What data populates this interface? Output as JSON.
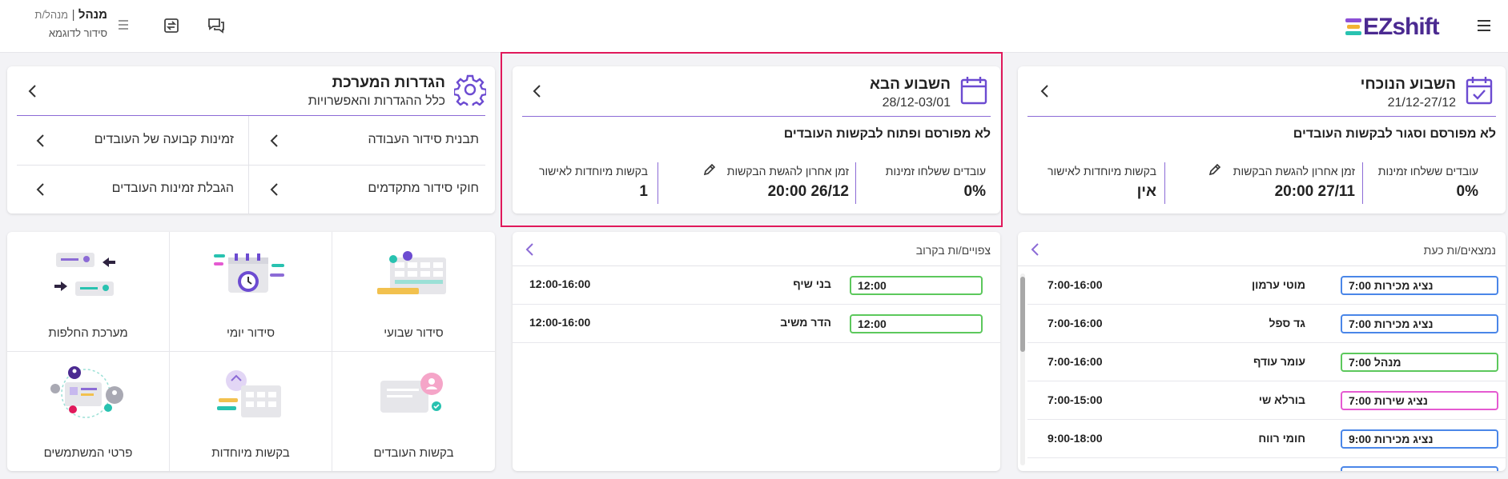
{
  "header": {
    "logo_text": "EZshift",
    "user_name": "מנהל",
    "user_role": "מנהל/ת",
    "separator": "|",
    "schedule_name": "סידור לדוגמא",
    "menu_icon": "hamburger-icon",
    "chat_icon": "chat-icon",
    "swap_icon": "swap-icon",
    "accent": "#6c4bd1"
  },
  "current_week": {
    "title": "השבוע הנוכחי",
    "dates": "21/12-27/12",
    "status": "לא מפורסם וסגור לבקשות העובדים",
    "stats": {
      "sent_label": "עובדים ששלחו זמינות",
      "sent_value": "0%",
      "deadline_label": "זמן אחרון להגשת הבקשות",
      "deadline_value": "27/11 20:00",
      "special_label": "בקשות מיוחדות לאישור",
      "special_value": "אין"
    }
  },
  "next_week": {
    "title": "השבוע הבא",
    "dates": "28/12-03/01",
    "status": "לא מפורסם ופתוח לבקשות העובדים",
    "stats": {
      "sent_label": "עובדים ששלחו זמינות",
      "sent_value": "0%",
      "deadline_label": "זמן אחרון להגשת הבקשות",
      "deadline_value": "26/12 20:00",
      "special_label": "בקשות מיוחדות לאישור",
      "special_value": "1"
    },
    "highlight_color": "#e0195b"
  },
  "settings": {
    "title": "הגדרות המערכת",
    "subtitle": "כלל ההגדרות והאפשרויות",
    "items": [
      {
        "label": "תבנית סידור העבודה"
      },
      {
        "label": "זמינות קבועה של העובדים"
      },
      {
        "label": "חוקי סידור מתקדמים"
      },
      {
        "label": "הגבלת זמינות העובדים"
      }
    ]
  },
  "present": {
    "heading": "נמצאים/ות כעת",
    "rows": [
      {
        "badge": "נציג מכירות 7:00",
        "name": "מוטי ערמון",
        "time": "7:00-16:00",
        "color": "#4a86e8"
      },
      {
        "badge": "נציג מכירות 7:00",
        "name": "גד ספל",
        "time": "7:00-16:00",
        "color": "#4a86e8"
      },
      {
        "badge": "מנהל 7:00",
        "name": "עומר עודף",
        "time": "7:00-16:00",
        "color": "#5cc85c"
      },
      {
        "badge": "נציג שירות 7:00",
        "name": "בורלא שי",
        "time": "7:00-15:00",
        "color": "#e55ad1"
      },
      {
        "badge": "נציג מכירות 9:00",
        "name": "חומי רווח",
        "time": "9:00-18:00",
        "color": "#4a86e8"
      }
    ]
  },
  "upcoming": {
    "heading": "צפויים/ות בקרוב",
    "rows": [
      {
        "badge": "12:00",
        "name": "בני שיף",
        "time": "12:00-16:00",
        "color": "#5cc85c"
      },
      {
        "badge": "12:00",
        "name": "הדר משיב",
        "time": "12:00-16:00",
        "color": "#5cc85c"
      }
    ]
  },
  "tiles": [
    {
      "label": "סידור שבועי",
      "icon": "weekly-schedule-icon"
    },
    {
      "label": "סידור יומי",
      "icon": "daily-schedule-icon"
    },
    {
      "label": "מערכת החלפות",
      "icon": "swap-system-icon"
    },
    {
      "label": "בקשות העובדים",
      "icon": "employee-requests-icon"
    },
    {
      "label": "בקשות מיוחדות",
      "icon": "special-requests-icon"
    },
    {
      "label": "פרטי המשתמשים",
      "icon": "users-details-icon"
    }
  ]
}
